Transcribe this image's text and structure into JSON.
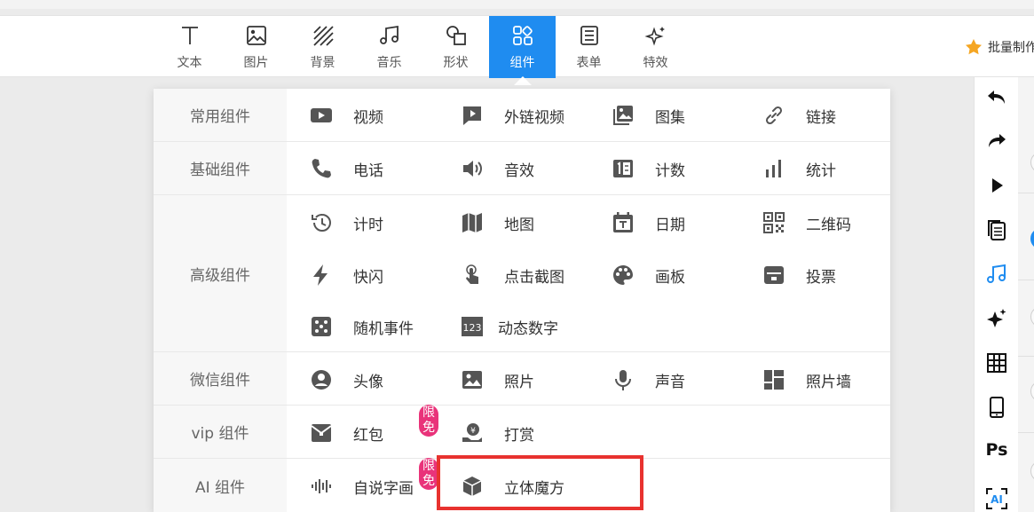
{
  "toolbar": {
    "tools": [
      {
        "label": "文本",
        "icon": "text-icon"
      },
      {
        "label": "图片",
        "icon": "image-icon"
      },
      {
        "label": "背景",
        "icon": "background-icon"
      },
      {
        "label": "音乐",
        "icon": "music-icon"
      },
      {
        "label": "形状",
        "icon": "shape-icon"
      },
      {
        "label": "组件",
        "icon": "component-icon",
        "active": true
      },
      {
        "label": "表单",
        "icon": "form-icon"
      },
      {
        "label": "特效",
        "icon": "effects-icon"
      }
    ],
    "batch_label": "批量制作",
    "active_color": "#1f8cf0"
  },
  "panel": {
    "categories": [
      {
        "label": "常用组件",
        "items": [
          {
            "label": "视频",
            "icon": "video-icon"
          },
          {
            "label": "外链视频",
            "icon": "external-video-icon"
          },
          {
            "label": "图集",
            "icon": "gallery-icon"
          },
          {
            "label": "链接",
            "icon": "link-icon"
          }
        ]
      },
      {
        "label": "基础组件",
        "items": [
          {
            "label": "电话",
            "icon": "phone-icon"
          },
          {
            "label": "音效",
            "icon": "sound-effect-icon"
          },
          {
            "label": "计数",
            "icon": "counter-icon"
          },
          {
            "label": "统计",
            "icon": "stats-icon"
          }
        ]
      },
      {
        "label": "高级组件",
        "items": [
          {
            "label": "计时",
            "icon": "timer-icon"
          },
          {
            "label": "地图",
            "icon": "map-icon"
          },
          {
            "label": "日期",
            "icon": "calendar-icon"
          },
          {
            "label": "二维码",
            "icon": "qrcode-icon"
          },
          {
            "label": "快闪",
            "icon": "flash-icon"
          },
          {
            "label": "点击截图",
            "icon": "click-screenshot-icon"
          },
          {
            "label": "画板",
            "icon": "palette-icon"
          },
          {
            "label": "投票",
            "icon": "vote-icon"
          },
          {
            "label": "随机事件",
            "icon": "dice-icon"
          },
          {
            "label": "动态数字",
            "icon": "dynamic-number-icon",
            "glyph": "123"
          }
        ]
      },
      {
        "label": "微信组件",
        "items": [
          {
            "label": "头像",
            "icon": "avatar-icon"
          },
          {
            "label": "照片",
            "icon": "photo-icon"
          },
          {
            "label": "声音",
            "icon": "microphone-icon"
          },
          {
            "label": "照片墙",
            "icon": "photo-wall-icon"
          }
        ]
      },
      {
        "label": "vip 组件",
        "items": [
          {
            "label": "红包",
            "icon": "red-packet-icon",
            "badge": "限免"
          },
          {
            "label": "打赏",
            "icon": "reward-icon"
          }
        ]
      },
      {
        "label": "AI 组件",
        "items": [
          {
            "label": "自说字画",
            "icon": "waveform-icon",
            "badge": "限免"
          },
          {
            "label": "立体魔方",
            "icon": "cube-icon",
            "highlighted": true
          }
        ]
      }
    ],
    "badge_color": "#e9337a",
    "highlight_color": "#e8322f"
  },
  "right_toolbar": {
    "buttons": [
      {
        "icon": "undo-icon"
      },
      {
        "icon": "redo-icon"
      },
      {
        "icon": "play-icon"
      },
      {
        "icon": "copy-pages-icon"
      },
      {
        "icon": "music-note-icon"
      },
      {
        "icon": "sparkle-icon"
      },
      {
        "icon": "grid-icon"
      },
      {
        "icon": "mobile-icon"
      },
      {
        "icon": "photoshop-icon",
        "text": "Ps"
      },
      {
        "icon": "ai-scan-icon",
        "text": "AI"
      }
    ]
  }
}
